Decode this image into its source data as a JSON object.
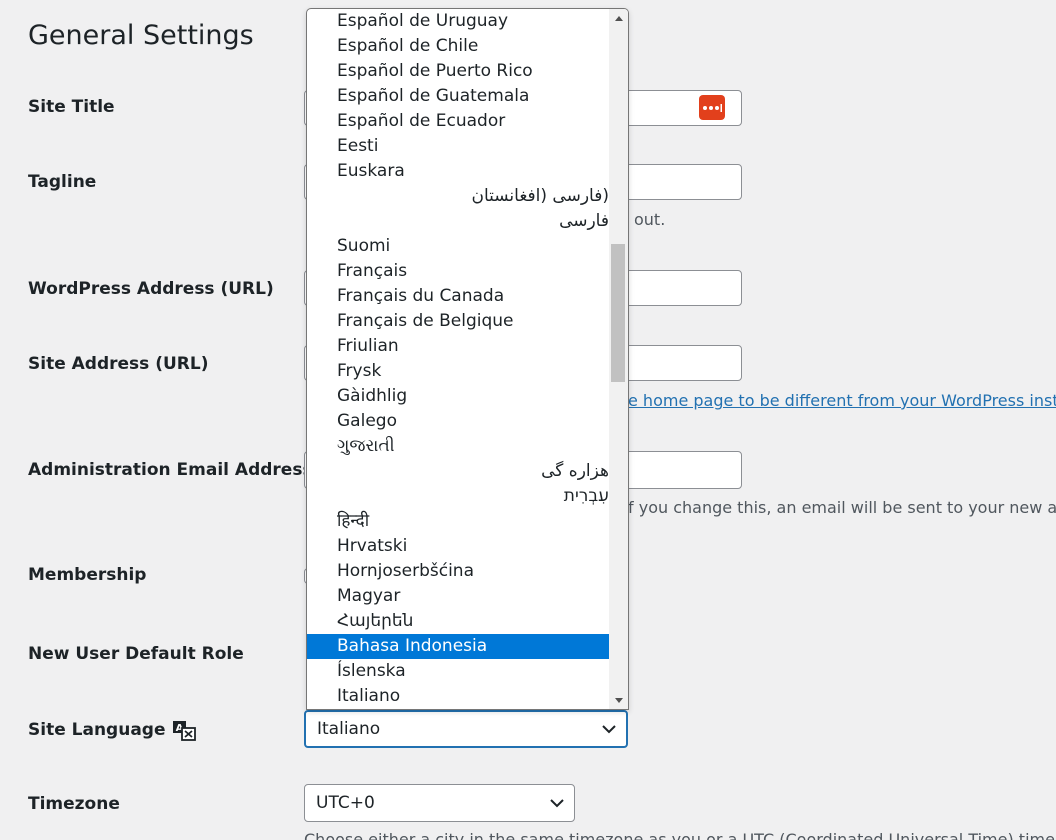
{
  "page": {
    "title": "General Settings"
  },
  "labels": {
    "site_title": "Site Title",
    "tagline": "Tagline",
    "wp_address": "WordPress Address (URL)",
    "site_address": "Site Address (URL)",
    "admin_email": "Administration Email Address",
    "membership": "Membership",
    "default_role": "New User Default Role",
    "site_language": "Site Language",
    "timezone": "Timezone"
  },
  "descriptions": {
    "tagline_tail": "out.",
    "site_address_link": "e home page to be different from your WordPress insta",
    "admin_email_tail": "f you change this, an email will be sent to your new add",
    "timezone_hint": "Choose either a city in the same timezone as you or a UTC (Coordinated Universal Time) time offs"
  },
  "site_language": {
    "selected": "Italiano",
    "options": [
      "Español de Uruguay",
      "Español de Chile",
      "Español de Puerto Rico",
      "Español de Guatemala",
      "Español de Ecuador",
      "Eesti",
      "Euskara",
      "(فارسی (افغانستان",
      "فارسی",
      "Suomi",
      "Français",
      "Français du Canada",
      "Français de Belgique",
      "Friulian",
      "Frysk",
      "Gàidhlig",
      "Galego",
      "ગુજરાતી",
      "هزاره گی",
      "עִבְרִית",
      "हिन्दी",
      "Hrvatski",
      "Hornjoserbšćina",
      "Magyar",
      "Հայերեն",
      "Bahasa Indonesia",
      "Íslenska",
      "Italiano"
    ],
    "highlighted": "Bahasa Indonesia",
    "scroll_position": 0.33
  },
  "timezone": {
    "selected": "UTC+0"
  },
  "colors": {
    "accent": "#2271b1",
    "highlight": "#0078d7",
    "password_manager": "#e2401c"
  },
  "icons": {
    "language": "translate-icon",
    "password_manager": "password-manager-icon",
    "chevron": "chevron-down-icon"
  }
}
